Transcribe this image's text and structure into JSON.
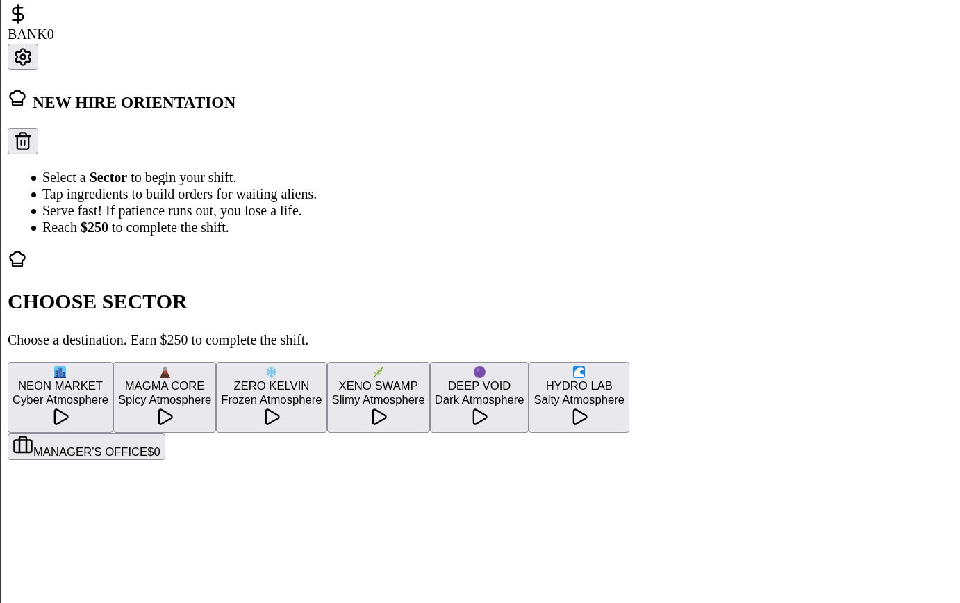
{
  "header": {
    "bank": {
      "label": "BANK",
      "value": "0"
    }
  },
  "orientation": {
    "title": "NEW HIRE ORIENTATION",
    "instructions": [
      "Select a **Sector** to begin your shift.",
      "Tap ingredients to build orders for waiting aliens.",
      "Serve fast! If patience runs out, you lose a life.",
      "Reach **$250** to complete the shift."
    ]
  },
  "sector_select": {
    "title": "CHOOSE SECTOR",
    "subtitle": "Choose a destination. Earn $250 to complete the shift.",
    "sectors": [
      {
        "kind": "city",
        "name": "NEON MARKET",
        "atmosphere": "Cyber Atmosphere"
      },
      {
        "kind": "volcano",
        "name": "MAGMA CORE",
        "atmosphere": "Spicy Atmosphere"
      },
      {
        "kind": "snowflake",
        "name": "ZERO KELVIN",
        "atmosphere": "Frozen Atmosphere"
      },
      {
        "kind": "herb",
        "name": "XENO SWAMP",
        "atmosphere": "Slimy Atmosphere"
      },
      {
        "kind": "orb",
        "name": "DEEP VOID",
        "atmosphere": "Dark Atmosphere"
      },
      {
        "kind": "wave",
        "name": "HYDRO LAB",
        "atmosphere": "Salty Atmosphere"
      }
    ]
  },
  "office": {
    "label": "MANAGER'S OFFICE",
    "balance": "$0"
  }
}
